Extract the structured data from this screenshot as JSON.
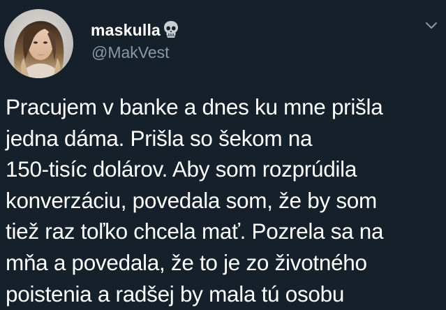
{
  "tweet": {
    "author": {
      "display_name": "maskulla",
      "name_emoji": "skull-icon",
      "handle": "@MakVest",
      "avatar": "profile-photo"
    },
    "menu_icon": "chevron-down-icon",
    "text_lines": [
      "Pracujem v banke a dnes ku mne prišla",
      "jedna dáma. Prišla so šekom na",
      "150-tisíc dolárov. Aby som rozprúdila",
      "konverzáciu, povedala som, že by som",
      "tiež raz toľko chcela mať. Pozrela sa na",
      "mňa a povedala, že to je zo životného",
      "poistenia a radšej by mala tú osobu"
    ]
  },
  "colors": {
    "background": "#15202b",
    "primary_text": "#ffffff",
    "secondary_text": "#8899a6"
  }
}
